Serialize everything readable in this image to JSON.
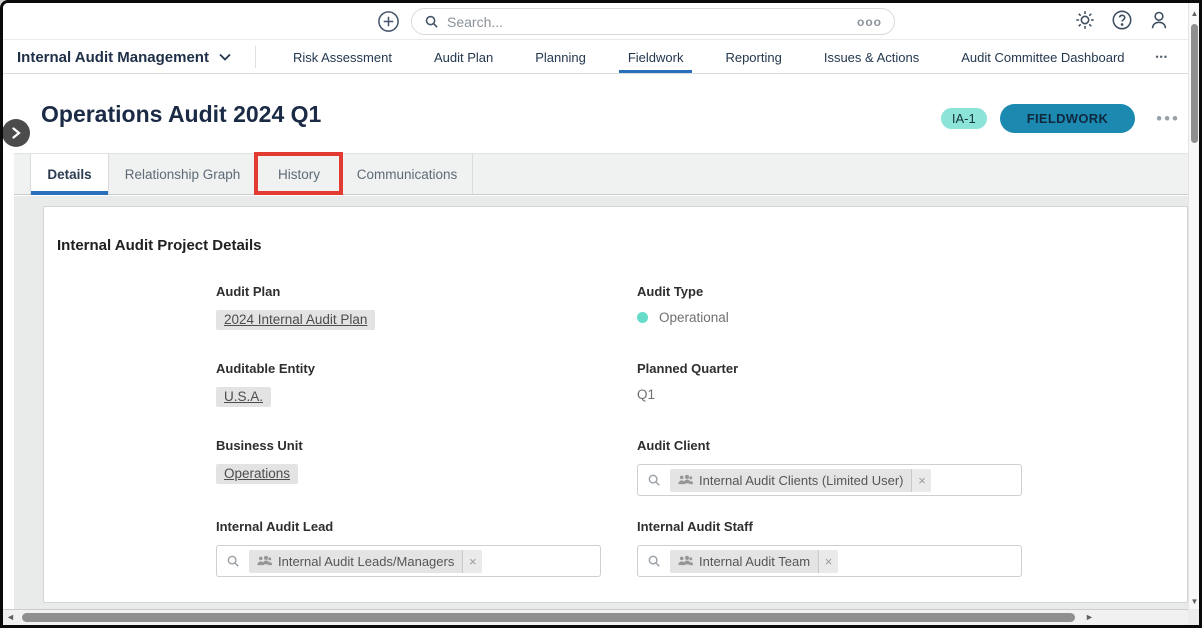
{
  "colors": {
    "accent_blue": "#2a6fbc",
    "status_teal_bg": "#1c8ab0",
    "id_badge_bg": "#8ce4d8",
    "highlight_red": "#e23b32",
    "audit_type_dot": "#66dcc9"
  },
  "topbar": {
    "search": {
      "placeholder": "Search...",
      "shortcut": "ooo"
    }
  },
  "nav": {
    "app_title": "Internal Audit Management",
    "items": [
      {
        "label": "Risk Assessment"
      },
      {
        "label": "Audit Plan"
      },
      {
        "label": "Planning"
      },
      {
        "label": "Fieldwork"
      },
      {
        "label": "Reporting"
      },
      {
        "label": "Issues & Actions"
      },
      {
        "label": "Audit Committee Dashboard"
      }
    ],
    "more_label": "•••"
  },
  "header": {
    "title": "Operations Audit 2024 Q1",
    "id_badge": "IA-1",
    "status_label": "FIELDWORK",
    "more_label": "•••"
  },
  "tabs": [
    {
      "label": "Details"
    },
    {
      "label": "Relationship Graph"
    },
    {
      "label": "History"
    },
    {
      "label": "Communications"
    }
  ],
  "form": {
    "section_title": "Internal Audit Project Details",
    "audit_plan": {
      "label": "Audit Plan",
      "value": "2024 Internal Audit Plan"
    },
    "audit_type": {
      "label": "Audit Type",
      "value": "Operational"
    },
    "auditable_entity": {
      "label": "Auditable Entity",
      "value": "U.S.A."
    },
    "planned_quarter": {
      "label": "Planned Quarter",
      "value": "Q1"
    },
    "business_unit": {
      "label": "Business Unit",
      "value": "Operations"
    },
    "audit_client": {
      "label": "Audit Client",
      "chip": "Internal Audit Clients (Limited User)",
      "remove_label": "×"
    },
    "internal_audit_lead": {
      "label": "Internal Audit Lead",
      "chip": "Internal Audit Leads/Managers",
      "remove_label": "×"
    },
    "internal_audit_staff": {
      "label": "Internal Audit Staff",
      "chip": "Internal Audit Team",
      "remove_label": "×"
    }
  },
  "scrollbars": {
    "up": "▲",
    "down": "▼",
    "left": "◄",
    "right": "►"
  }
}
